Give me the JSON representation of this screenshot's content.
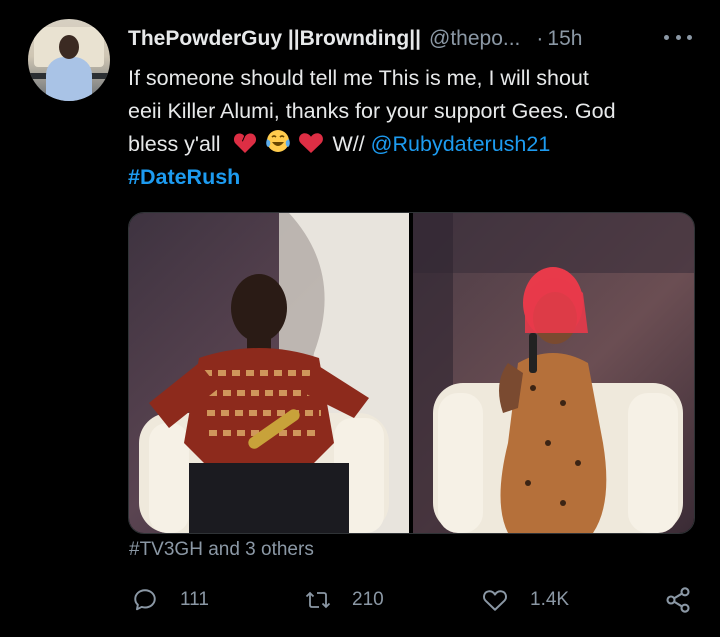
{
  "tweet": {
    "display_name": "ThePowderGuy ||Brownding||",
    "handle": "@thepo...",
    "separator": "·",
    "time": "15h",
    "text_line1": "If someone should tell me This is me, I will shout",
    "text_line2": "eeii Killer Alumi, thanks for your support Gees. God",
    "text_line3": "bless y'all",
    "text_after_emoji": " W// ",
    "mention": "@Rubydaterush21",
    "hashtag": "#DateRush",
    "emojis": [
      "broken-heart",
      "face-with-tears-of-joy",
      "red-heart"
    ]
  },
  "media": {
    "images": [
      "man-in-patterned-shirt-with-microphone",
      "woman-with-red-hair-in-leopard-dress"
    ]
  },
  "hashtags_line": "#TV3GH and 3 others",
  "actions": {
    "replies": "111",
    "retweets": "210",
    "likes": "1.4K"
  },
  "colors": {
    "background": "#000000",
    "text": "#e7e9ea",
    "secondary": "#8b98a5",
    "link": "#1d9bf0"
  }
}
